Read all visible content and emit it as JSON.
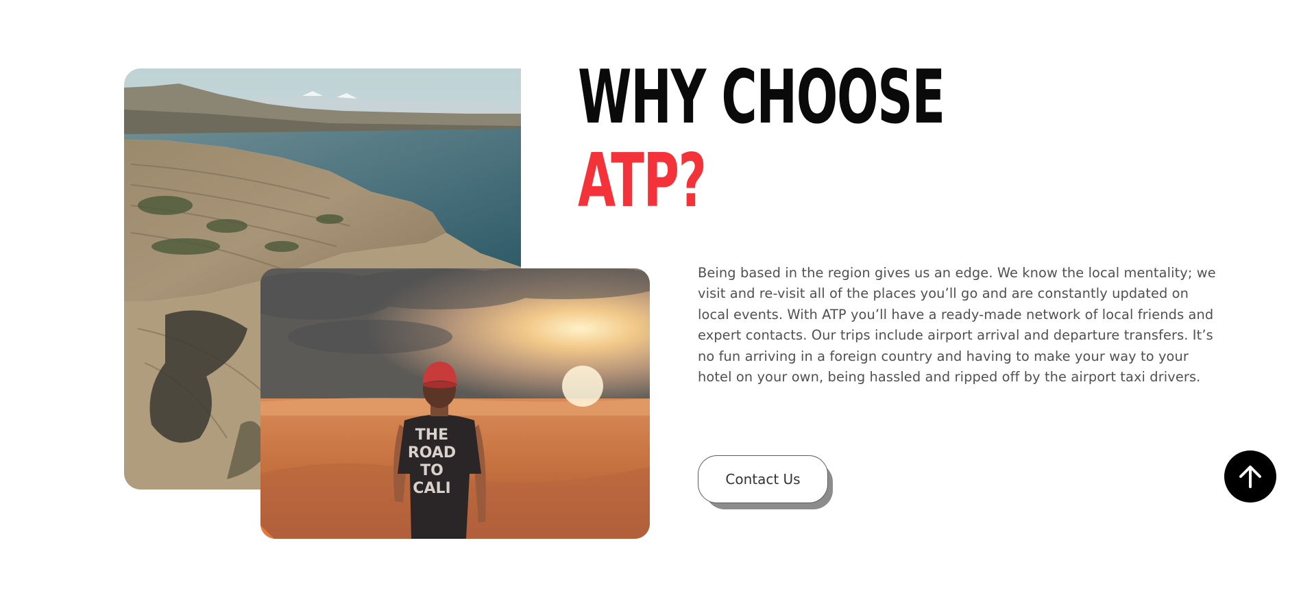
{
  "section": {
    "heading_line1": "WHY CHOOSE",
    "heading_line2": "ATP?",
    "paragraph": "Being based in the region gives us an edge. We know the local mentality; we visit and re-visit all of the places you’ll go and are constantly updated on local events. With ATP you’ll have a ready-made network of local friends and expert contacts. Our trips include airport arrival and departure transfers. It’s no fun arriving in a foreign country and having to make your way to your hotel on your own, being hassled and ripped off by the airport taxi drivers.",
    "contact_label": "Contact Us"
  },
  "images": {
    "desert_shirt_text": [
      "THE",
      "ROAD",
      "TO",
      "CALI"
    ]
  },
  "icons": {
    "scroll_top": "arrow-up-icon"
  },
  "colors": {
    "heading_dark": "#0a0a0a",
    "accent_red": "#f4323a",
    "body_text": "#505050",
    "button_shadow": "#8c8c8c",
    "scroll_button": "#000000"
  }
}
